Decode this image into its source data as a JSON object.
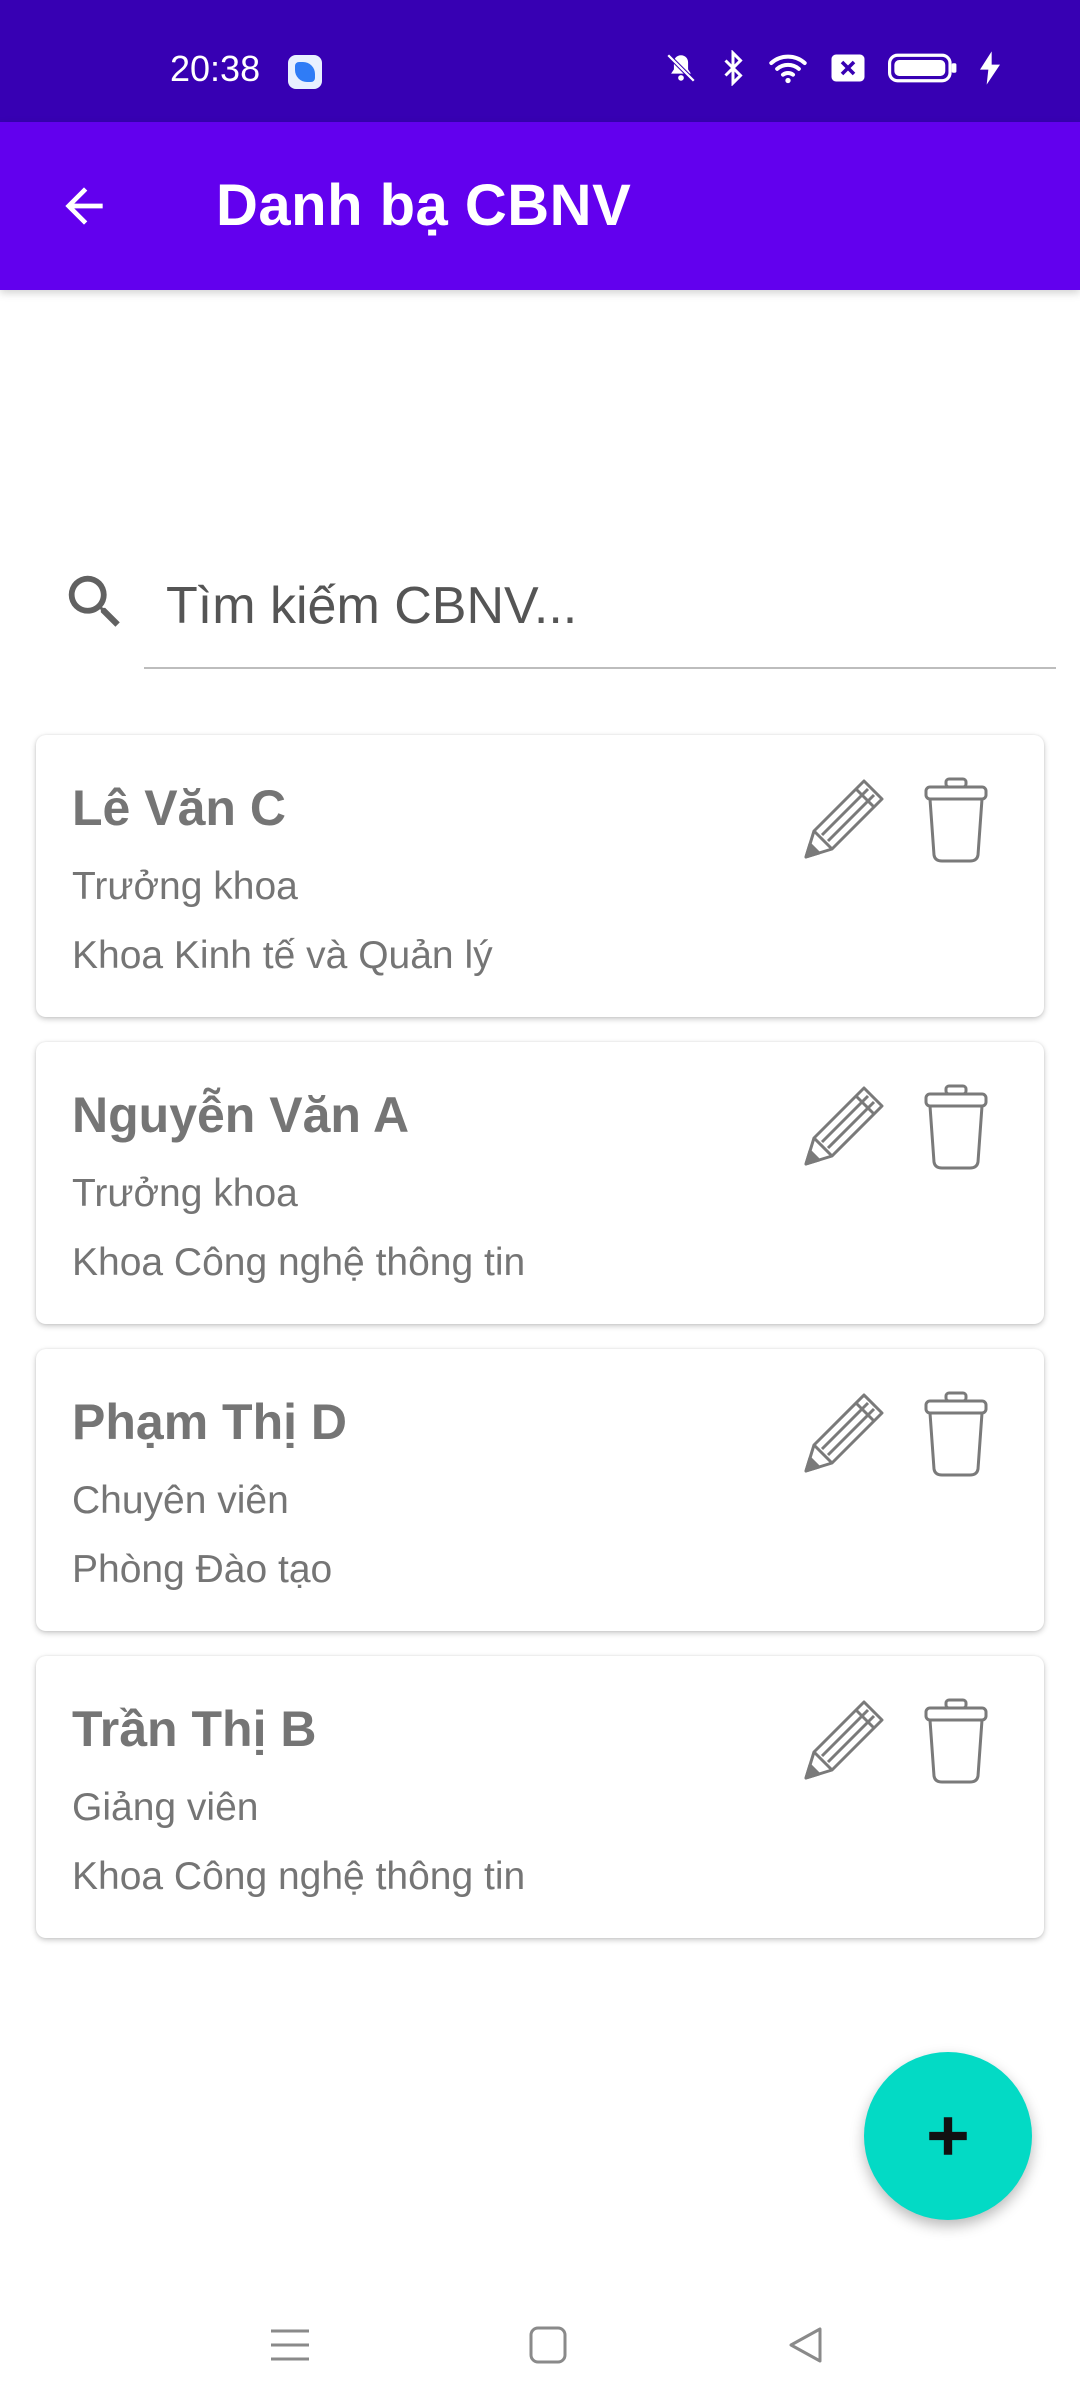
{
  "status_bar": {
    "time": "20:38",
    "icons": [
      "app-notification-icon",
      "mute-icon",
      "bluetooth-icon",
      "wifi-icon",
      "sim-off-icon",
      "battery-icon",
      "charging-icon"
    ]
  },
  "app_bar": {
    "title": "Danh bạ CBNV",
    "background": "#6200ee",
    "status_background": "#3700b3"
  },
  "search": {
    "placeholder": "Tìm kiếm CBNV...",
    "value": ""
  },
  "employees": [
    {
      "name": "Lê Văn C",
      "role": "Trưởng khoa",
      "department": "Khoa Kinh tế và Quản lý"
    },
    {
      "name": "Nguyễn Văn A",
      "role": "Trưởng khoa",
      "department": "Khoa Công nghệ thông tin"
    },
    {
      "name": "Phạm Thị D",
      "role": "Chuyên viên",
      "department": "Phòng Đào tạo"
    },
    {
      "name": "Trần Thị B",
      "role": "Giảng viên",
      "department": "Khoa Công nghệ thông tin"
    }
  ],
  "fab": {
    "icon": "plus-icon",
    "color": "#03dac5"
  },
  "nav_bar": {
    "buttons": [
      "menu-icon",
      "home-icon",
      "back-triangle-icon"
    ]
  }
}
